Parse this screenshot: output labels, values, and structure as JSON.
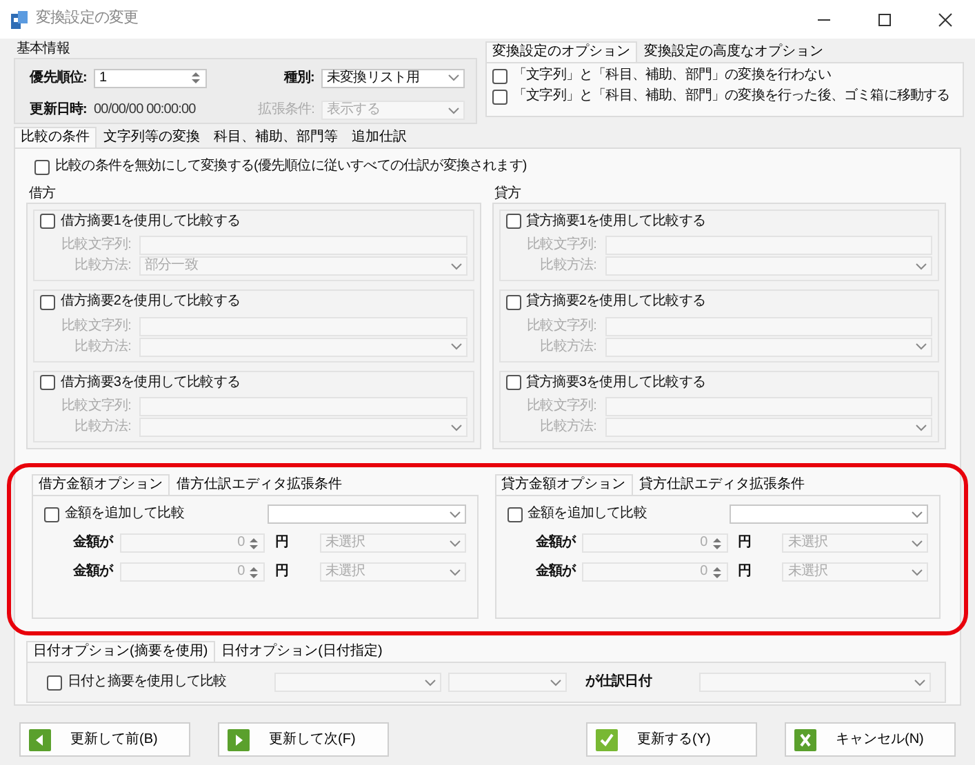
{
  "window": {
    "title": "変換設定の変更"
  },
  "basic_info": {
    "title": "基本情報",
    "priority": {
      "label": "優先順位:",
      "value": "1"
    },
    "type": {
      "label": "種別:",
      "value": "未変換リスト用"
    },
    "updated": {
      "label": "更新日時:",
      "value": "00/00/00 00:00:00"
    },
    "extension": {
      "label": "拡張条件:",
      "value": "表示する",
      "disabled": true
    }
  },
  "options": {
    "tabs": [
      {
        "label": "変換設定のオプション",
        "selected": true
      },
      {
        "label": "変換設定の高度なオプション",
        "selected": false
      }
    ],
    "checkboxes": [
      {
        "label": "「文字列」と「科目、補助、部門」の変換を行わない",
        "checked": false
      },
      {
        "label": "「文字列」と「科目、補助、部門」の変換を行った後、ゴミ箱に移動する",
        "checked": false
      }
    ]
  },
  "main_tabs": [
    {
      "label": "比較の条件",
      "selected": true
    },
    {
      "label": "文字列等の変換",
      "selected": false
    },
    {
      "label": "科目、補助、部門等",
      "selected": false
    },
    {
      "label": "追加仕訳",
      "selected": false
    }
  ],
  "disable_compare": {
    "label": "比較の条件を無効にして変換する(優先順位に従いすべての仕訳が変換されます)",
    "checked": false
  },
  "sides": [
    {
      "title": "借方",
      "rows": [
        {
          "label": "借方摘要1を使用して比較する",
          "checked": false,
          "string_label": "比較文字列:",
          "method_label": "比較方法:",
          "method_value": "部分一致"
        },
        {
          "label": "借方摘要2を使用して比較する",
          "checked": false,
          "string_label": "比較文字列:",
          "method_label": "比較方法:"
        },
        {
          "label": "借方摘要3を使用して比較する",
          "checked": false,
          "string_label": "比較文字列:",
          "method_label": "比較方法:"
        }
      ]
    },
    {
      "title": "貸方",
      "rows": [
        {
          "label": "貸方摘要1を使用して比較する",
          "checked": false,
          "string_label": "比較文字列:",
          "method_label": "比較方法:"
        },
        {
          "label": "貸方摘要2を使用して比較する",
          "checked": false,
          "string_label": "比較文字列:",
          "method_label": "比較方法:"
        },
        {
          "label": "貸方摘要3を使用して比較する",
          "checked": false,
          "string_label": "比較文字列:",
          "method_label": "比較方法:"
        }
      ]
    }
  ],
  "amount_panels": [
    {
      "tabs": [
        {
          "label": "借方金額オプション",
          "selected": true
        },
        {
          "label": "借方仕訳エディタ拡張条件",
          "selected": false
        }
      ],
      "checkbox": {
        "label": "金額を追加して比較",
        "checked": false
      },
      "rows": [
        {
          "label": "金額が",
          "value": "0",
          "unit": "円",
          "select": "未選択"
        },
        {
          "label": "金額が",
          "value": "0",
          "unit": "円",
          "select": "未選択"
        }
      ]
    },
    {
      "tabs": [
        {
          "label": "貸方金額オプション",
          "selected": true
        },
        {
          "label": "貸方仕訳エディタ拡張条件",
          "selected": false
        }
      ],
      "checkbox": {
        "label": "金額を追加して比較",
        "checked": false
      },
      "rows": [
        {
          "label": "金額が",
          "value": "0",
          "unit": "円",
          "select": "未選択"
        },
        {
          "label": "金額が",
          "value": "0",
          "unit": "円",
          "select": "未選択"
        }
      ]
    }
  ],
  "amount_panels_highlighted": true,
  "date_options": {
    "tabs": [
      {
        "label": "日付オプション(摘要を使用)",
        "selected": true
      },
      {
        "label": "日付オプション(日付指定)",
        "selected": false
      }
    ],
    "checkbox": {
      "label": "日付と摘要を使用して比較",
      "checked": false
    },
    "suffix": "が仕訳日付"
  },
  "buttons": [
    {
      "label": "更新して前(B)",
      "kind": "prev"
    },
    {
      "label": "更新して次(F)",
      "kind": "next"
    },
    {
      "label": "更新する(Y)",
      "kind": "ok"
    },
    {
      "label": "キャンセル(N)",
      "kind": "cancel"
    }
  ]
}
